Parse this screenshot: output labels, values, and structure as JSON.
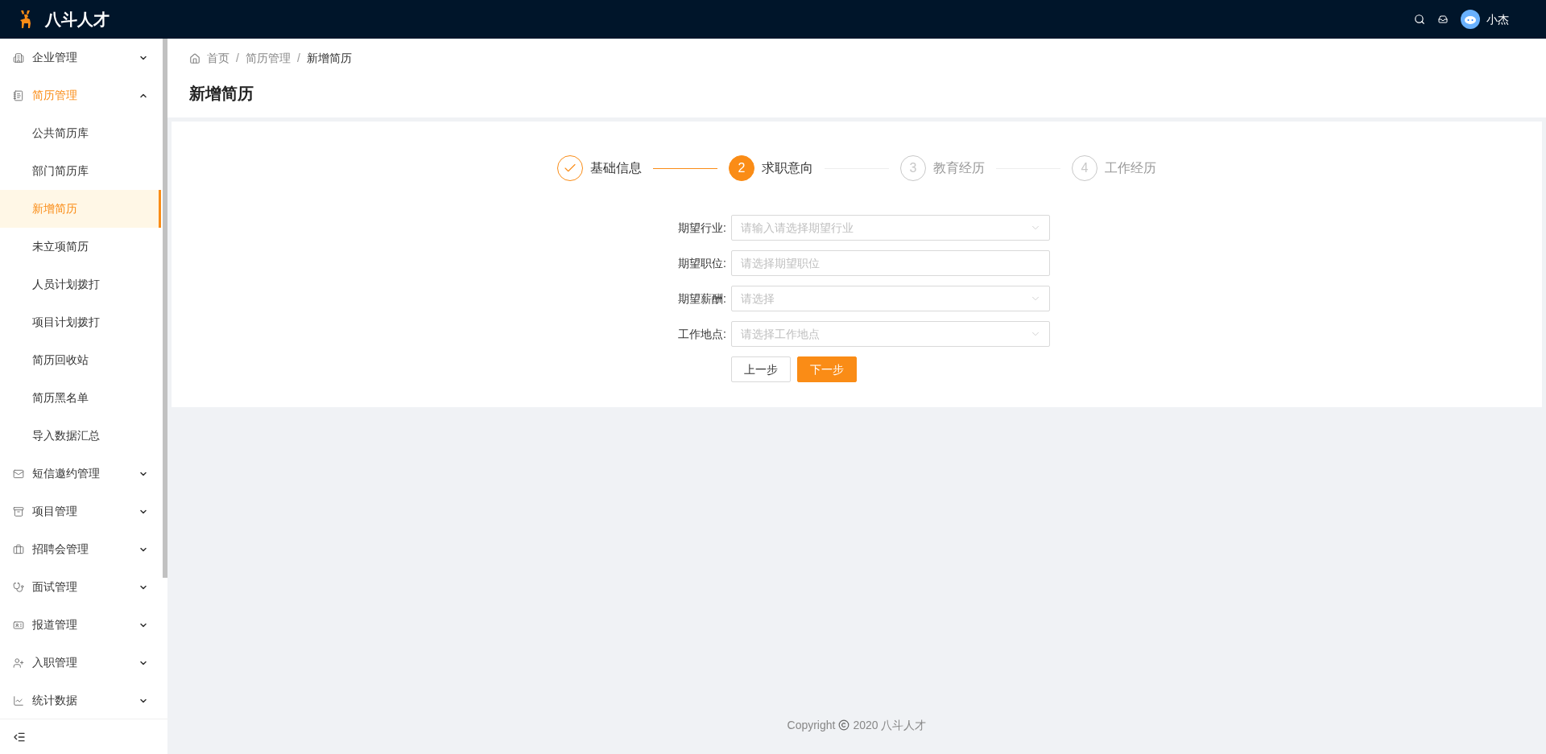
{
  "header": {
    "brand": "八斗人才",
    "user": "小杰"
  },
  "sidebar": {
    "items": [
      {
        "label": "企业管理",
        "expanded": false,
        "active": false
      },
      {
        "label": "简历管理",
        "expanded": true,
        "active": true,
        "children": [
          {
            "label": "公共简历库",
            "selected": false
          },
          {
            "label": "部门简历库",
            "selected": false
          },
          {
            "label": "新增简历",
            "selected": true
          },
          {
            "label": "未立项简历",
            "selected": false
          },
          {
            "label": "人员计划拨打",
            "selected": false
          },
          {
            "label": "项目计划拨打",
            "selected": false
          },
          {
            "label": "简历回收站",
            "selected": false
          },
          {
            "label": "简历黑名单",
            "selected": false
          },
          {
            "label": "导入数据汇总",
            "selected": false
          }
        ]
      },
      {
        "label": "短信邀约管理",
        "expanded": false,
        "active": false
      },
      {
        "label": "项目管理",
        "expanded": false,
        "active": false
      },
      {
        "label": "招聘会管理",
        "expanded": false,
        "active": false
      },
      {
        "label": "面试管理",
        "expanded": false,
        "active": false
      },
      {
        "label": "报道管理",
        "expanded": false,
        "active": false
      },
      {
        "label": "入职管理",
        "expanded": false,
        "active": false
      },
      {
        "label": "统计数据",
        "expanded": false,
        "active": false
      }
    ]
  },
  "breadcrumb": [
    "首页",
    "简历管理",
    "新增简历"
  ],
  "breadcrumb_separator": "/",
  "page_title": "新增简历",
  "steps": [
    {
      "label": "基础信息",
      "completed": true,
      "selected": false
    },
    {
      "label": "求职意向",
      "completed": false,
      "selected": true,
      "number": "2"
    },
    {
      "label": "教育经历",
      "completed": false,
      "selected": false,
      "number": "3"
    },
    {
      "label": "工作经历",
      "completed": false,
      "selected": false,
      "number": "4"
    }
  ],
  "form": {
    "fields": [
      {
        "label": "期望行业:",
        "kind": "select",
        "placeholder": "请输入请选择期望行业"
      },
      {
        "label": "期望职位:",
        "kind": "input",
        "placeholder": "请选择期望职位"
      },
      {
        "label": "期望薪酬:",
        "kind": "select",
        "placeholder": "请选择"
      },
      {
        "label": "工作地点:",
        "kind": "select",
        "placeholder": "请选择工作地点"
      }
    ],
    "buttons": [
      {
        "label": "上一步",
        "kind": "default"
      },
      {
        "label": "下一步",
        "kind": "primary"
      }
    ]
  },
  "footer": {
    "prefix": "Copyright",
    "text": "2020 八斗人才"
  }
}
